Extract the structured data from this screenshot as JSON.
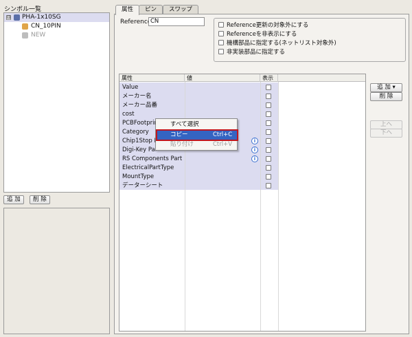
{
  "left_panel": {
    "title": "シンボル一覧",
    "tree": [
      {
        "label": "PHA-1x10SG",
        "expander": "⊟"
      },
      {
        "label": "CN_10PIN"
      },
      {
        "label": "NEW"
      }
    ],
    "add_label": "追 加",
    "delete_label": "削 除"
  },
  "tabs": [
    "属性",
    "ピン",
    "スワップ"
  ],
  "reference": {
    "label": "Reference",
    "value": "CN"
  },
  "checkboxes": [
    "Reference更新の対象外にする",
    "Referenceを非表示にする",
    "機構部品に指定する(ネットリスト対象外)",
    "非実装部品に指定する"
  ],
  "table": {
    "headers": [
      "属性",
      "値",
      "表示"
    ],
    "rows": [
      {
        "name": "Value",
        "info": false
      },
      {
        "name": "メーカー名",
        "info": false
      },
      {
        "name": "メーカー品番",
        "info": false
      },
      {
        "name": "cost",
        "info": false
      },
      {
        "name": "PCBFootprint",
        "info": false
      },
      {
        "name": "Category",
        "info": false
      },
      {
        "name": "Chip1Stop P",
        "info": true
      },
      {
        "name": "Digi-Key Par",
        "info": true
      },
      {
        "name": "RS Components Part…",
        "info": true
      },
      {
        "name": "ElectricalPartType",
        "info": false
      },
      {
        "name": "MountType",
        "info": false
      },
      {
        "name": "データーシート",
        "info": false
      }
    ]
  },
  "side_buttons": {
    "add": "追 加 ▾",
    "delete": "削 除",
    "up": "上へ",
    "down": "下へ"
  },
  "context_menu": {
    "select_all": "すべて選択",
    "copy": "コピー",
    "copy_shortcut": "Ctrl+C",
    "paste": "貼り付け",
    "paste_shortcut": "Ctrl+V"
  },
  "icons": {
    "info": "info-icon",
    "tree_root": "component-icon",
    "tree_child": "symbol-icon"
  }
}
